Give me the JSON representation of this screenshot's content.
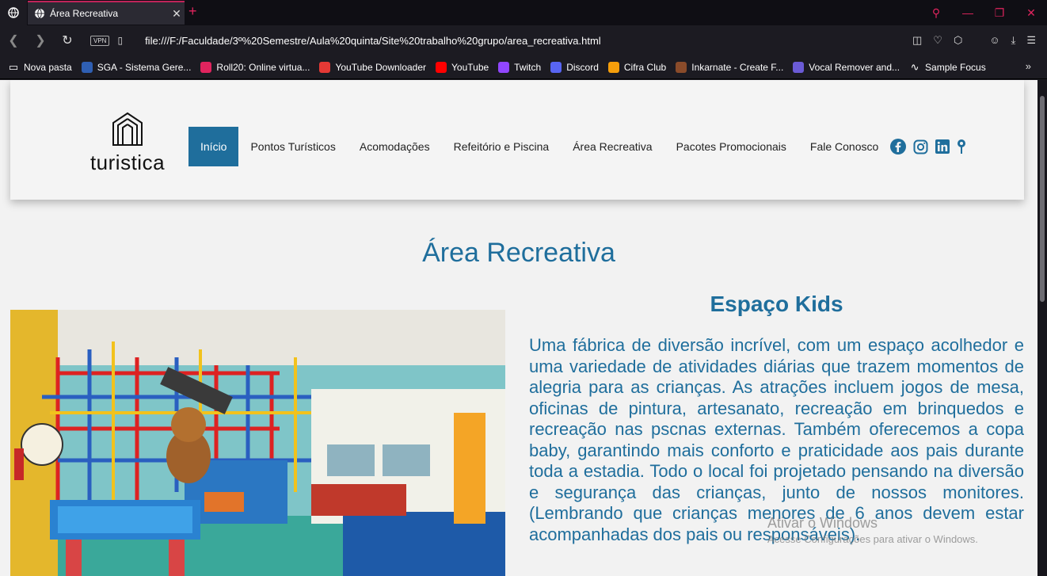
{
  "browser": {
    "tab_title": "Área Recreativa",
    "tab_close": "✕",
    "new_tab": "+",
    "url": "file:///F:/Faculdade/3º%20Semestre/Aula%20quinta/Site%20trabalho%20grupo/area_recreativa.html",
    "vpn_label": "VPN",
    "bookmarks": [
      {
        "label": "Nova pasta",
        "icon": "folder-icon",
        "color": "#1c1b22"
      },
      {
        "label": "SGA - Sistema Gere...",
        "icon": "sga-icon",
        "color": "#2f5fb3"
      },
      {
        "label": "Roll20: Online virtua...",
        "icon": "roll20-icon",
        "color": "#e0245e"
      },
      {
        "label": "YouTube Downloader",
        "icon": "download-icon",
        "color": "#e53935"
      },
      {
        "label": "YouTube",
        "icon": "youtube-icon",
        "color": "#ff0000"
      },
      {
        "label": "Twitch",
        "icon": "twitch-icon",
        "color": "#9146ff"
      },
      {
        "label": "Discord",
        "icon": "discord-icon",
        "color": "#5865f2"
      },
      {
        "label": "Cifra Club",
        "icon": "cifra-club-icon",
        "color": "#f59e0b"
      },
      {
        "label": "Inkarnate - Create F...",
        "icon": "inkarnate-icon",
        "color": "#8a4b2a"
      },
      {
        "label": "Vocal Remover and...",
        "icon": "vocal-remover-icon",
        "color": "#6b5bd6"
      },
      {
        "label": "Sample Focus",
        "icon": "waveform-icon",
        "color": "#1c1b22"
      }
    ]
  },
  "site": {
    "logo_text": "turistica",
    "menu": [
      {
        "label": "Início",
        "active": true
      },
      {
        "label": "Pontos Turísticos",
        "active": false
      },
      {
        "label": "Acomodações",
        "active": false
      },
      {
        "label": "Refeitório e Piscina",
        "active": false
      },
      {
        "label": "Área Recreativa",
        "active": false
      },
      {
        "label": "Pacotes Promocionais",
        "active": false
      },
      {
        "label": "Fale Conosco",
        "active": false
      }
    ],
    "accent_color": "#1f6e9c",
    "page_title": "Área Recreativa",
    "section_title": "Espaço Kids",
    "section_text": "Uma fábrica de diversão incrível, com um espaço acolhedor e uma variedade de atividades diárias que trazem momentos de alegria para as crianças. As atrações incluem jogos de mesa, oficinas de pintura, artesanato, recreação em brinquedos e recreação nas pscnas externas. Também oferecemos a copa baby, garantindo mais conforto e praticidade aos pais durante toda a estadia. Todo o local foi projetado pensando na diversão e segurança das crianças, junto de nossos monitores. (Lembrando que crianças menores de 6 anos devem estar acompanhadas dos pais ou responsáveis)."
  },
  "watermark": {
    "line1": "Ativar o Windows",
    "line2": "Acesse Configurações para ativar o Windows."
  }
}
